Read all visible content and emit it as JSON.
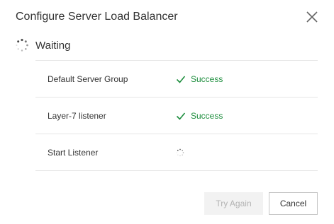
{
  "dialog": {
    "title": "Configure Server Load Balancer",
    "close_icon": "close-icon"
  },
  "status": {
    "text": "Waiting",
    "icon": "spinner-icon"
  },
  "steps": [
    {
      "name": "Default Server Group",
      "status": "Success",
      "state": "success"
    },
    {
      "name": "Layer-7 listener",
      "status": "Success",
      "state": "success"
    },
    {
      "name": "Start Listener",
      "status": "",
      "state": "loading"
    }
  ],
  "buttons": {
    "try_again": "Try Again",
    "cancel": "Cancel"
  },
  "colors": {
    "success": "#1e8e3e",
    "disabled_bg": "#f2f2f2",
    "disabled_text": "#b3b3b3",
    "border": "#e6e6e6"
  }
}
